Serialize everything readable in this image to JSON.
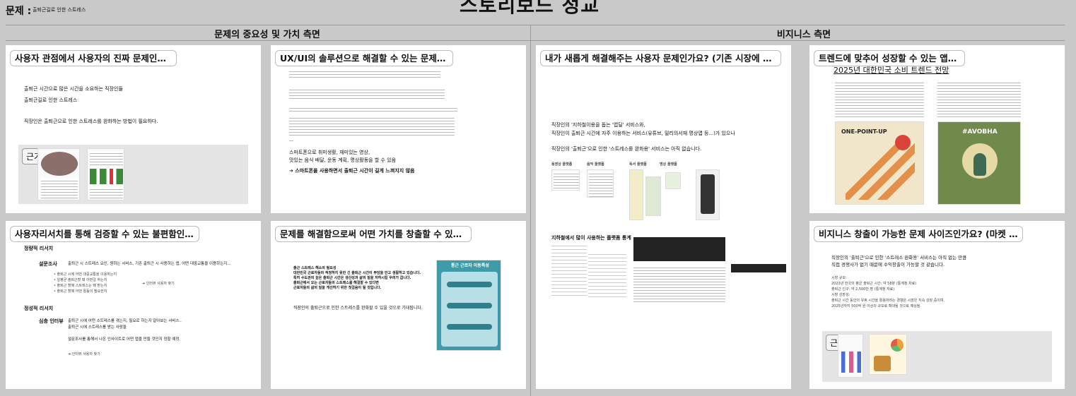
{
  "header": {
    "problem_label": "문제 :",
    "problem_text": "출퇴근길로 인한 스트레스",
    "main_title": "스토리보드 정교"
  },
  "sections": {
    "left": "문제의 중요성 및 가치 측면",
    "right": "비지니스 측면"
  },
  "evidence_label": "근거",
  "cards": {
    "c1": {
      "title": "사용자 관점에서 사용자의 진짜 문제인가요?",
      "lines": [
        "출퇴근 시간으로 많은 시간을 소요하는 직장인들",
        "출퇴근길로 인한 스트레스",
        "직장인은 출퇴근으로 인한 스트레스를 완화하는 방법이 필요하다."
      ]
    },
    "c2": {
      "title": "UX/UI의 솔루션으로 해결할 수 있는 문제인가요?",
      "lines": [
        "스마트폰으로 취미생활, 재미있는 영상,",
        "맛있는 음식 배달, 운동 계획, 명상활동을 할 수 있음",
        "➔ 스마트폰을 사용하면서 출퇴근 시간이 길게 느껴지지 않음"
      ]
    },
    "c3": {
      "title": "내가 새롭게 해결해주는 사용자 문제인가요? (기존 시장에 없는 서비스...",
      "lines": [
        "직장인의 '지하철이용을 돕는 '앱딜' 서비스와,",
        "직장인이 출퇴근 시간에 자주 이용하는 서비스(유튜브, 밀리의서재 명상앱 등...)가 있으나",
        "직장인의 '출퇴근'으로 인한 '스트레스를 완화용' 서비스는 아직 없습니다."
      ],
      "categories": [
        "동영상 플랫폼",
        "음악 플랫폼",
        "독서 플랫폼",
        "명상 플랫폼"
      ],
      "chart_title": "지하철에서 많이 사용하는 플랫폼 통계"
    },
    "c4": {
      "title": "트렌드에 맞추어 성장할 수 있는 앱인가?",
      "subtitle": "2025년 대한민국 소비 트렌드 전망",
      "img1": "ONE-POINT-UP",
      "img2": "#AVOBHA"
    },
    "c5": {
      "title": "사용자리서치를 통해 검증할 수 있는 불편함인가요?",
      "quant": "정량적 리서치",
      "survey": "설문조사",
      "survey_desc": "출퇴근 시 스트레스 요인, 원하는 서비스, 기존 출퇴근 시 사용하는 앱, 어떤 대중교통을 이용하는지...",
      "bullets": [
        "• 출퇴근 시에 어떤 대중교통을 이용하는지",
        "• 일평균 출퇴근할 때 어떤걸 하는지",
        "• 출퇴근 할때 스트레스는 왜 받는지",
        "• 출퇴근 할때 어떤 활동이 필요한지"
      ],
      "arrow1": "➔ 인터뷰 사용자 찾기",
      "qual": "정성적 리서치",
      "interview": "심층 인터뷰",
      "interview_desc": [
        "출퇴근 시에 어떤 스트레스를 겪는지, 필요로 하는지 알아보는 서비스..",
        "출퇴근 시에 스트레스를 받는 사람들"
      ],
      "summary": "설문조사를 통해서 나온 인사이트로 어떤 앱을 만들 것인지 정할 예정",
      "arrow2": "➔ 인터뷰 사용자 찾기"
    },
    "c6": {
      "title": "문제를 해결함으로써 어떤 가치를 창출할 수 있을까요?",
      "lines": [
        "출근 스트레스 해소의 필요성",
        "대한민국 근로자들의 적정하지 못한 긴 출퇴근 시간이 부담을 안고 생활하고 있습니다.",
        "특히 수도권의 높은 출퇴근 시간은 생산성과 삶의 질을 저하시킬 우려가 큽니다.",
        "출퇴근에서 오는 근로자들의 스트레스를 해결할 수 있다면",
        "근로자들의 삶의 질을 개선하기 위한 첫걸음이 될 것입니다."
      ],
      "closing": "직장인의 출퇴근으로 인한 스트레스를 완화할 수 있을 것으로 기대됩니다.",
      "poster_title": "통근 근로자 이동특성"
    },
    "c7": {
      "title": "비지니스 창출이 가능한 문제 사이즈인가요? (마켓 리서치)",
      "lines": [
        "직장인의 '출퇴근'으로 인한 '스트레스 완화용' 서비스는 아직 없는 만큼",
        "직접 경쟁사가 없기 때문에 수익창출이 가능할 것 같습니다."
      ],
      "market": [
        "시장 규모:",
        "2023년 한국의 평균 출퇴근 시간: 약 58분 (통계청 자료)",
        "출퇴근 인구: 약 2,500만 명 (통계청 자료)",
        "시장 성장성:",
        "출퇴근 시간 동안의 유휴 시간을 활용하려는 경향은 시장은 지속 성장 중이며,",
        "2025년까지 500억 원 이상의 규모로 확대될 것으로 예상됨."
      ]
    }
  }
}
